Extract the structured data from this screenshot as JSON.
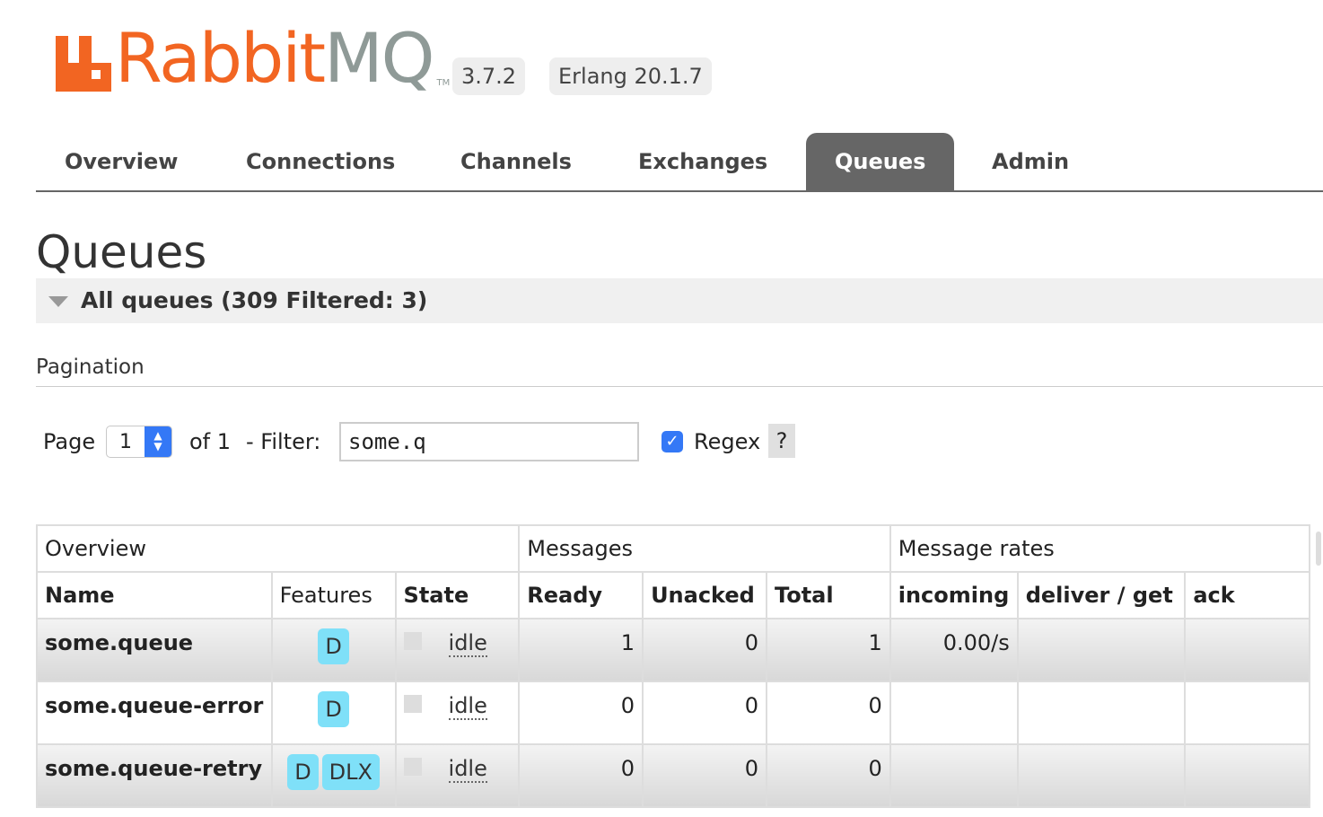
{
  "header": {
    "logo_rabbit": "Rabbit",
    "logo_mq": "MQ",
    "logo_tm": "TM",
    "version": "3.7.2",
    "erlang": "Erlang 20.1.7"
  },
  "nav": {
    "tabs": [
      {
        "label": "Overview"
      },
      {
        "label": "Connections"
      },
      {
        "label": "Channels"
      },
      {
        "label": "Exchanges"
      },
      {
        "label": "Queues",
        "active": true
      },
      {
        "label": "Admin"
      }
    ]
  },
  "page": {
    "title": "Queues",
    "section": "All queues (309 Filtered: 3)",
    "pagination": "Pagination"
  },
  "controls": {
    "page_label": "Page",
    "page_value": "1",
    "of_label": "of 1",
    "filter_label": "- Filter:",
    "filter_value": "some.q",
    "regex_label": "Regex",
    "regex_checked": true,
    "help": "?"
  },
  "table": {
    "groups": [
      "Overview",
      "Messages",
      "Message rates"
    ],
    "columns": [
      "Name",
      "Features",
      "State",
      "Ready",
      "Unacked",
      "Total",
      "incoming",
      "deliver / get",
      "ack"
    ],
    "rows": [
      {
        "name": "some.queue",
        "features": [
          "D"
        ],
        "state": "idle",
        "ready": "1",
        "unacked": "0",
        "total": "1",
        "incoming": "0.00/s",
        "deliver_get": "",
        "ack": ""
      },
      {
        "name": "some.queue-error",
        "features": [
          "D"
        ],
        "state": "idle",
        "ready": "0",
        "unacked": "0",
        "total": "0",
        "incoming": "",
        "deliver_get": "",
        "ack": ""
      },
      {
        "name": "some.queue-retry",
        "features": [
          "D",
          "DLX"
        ],
        "state": "idle",
        "ready": "0",
        "unacked": "0",
        "total": "0",
        "incoming": "",
        "deliver_get": "",
        "ack": ""
      }
    ]
  },
  "colors": {
    "brand_orange": "#f26522",
    "brand_grey": "#8f9a97",
    "active_tab": "#666666",
    "feature_tag": "#7fe0f8",
    "checkbox": "#3478f6"
  }
}
